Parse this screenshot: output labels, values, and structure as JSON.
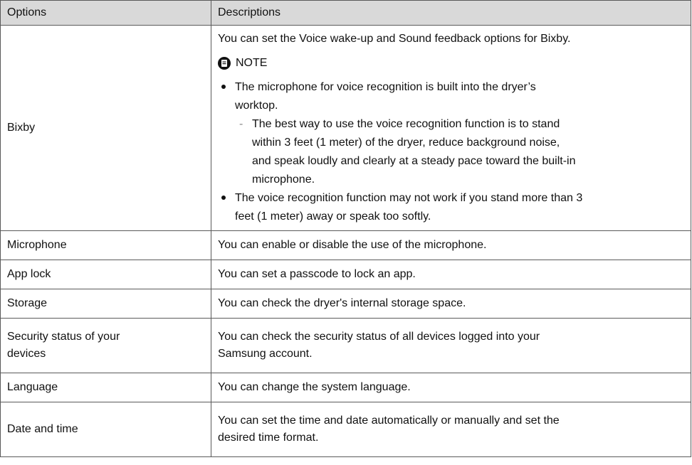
{
  "header": {
    "col_options": "Options",
    "col_descriptions": "Descriptions"
  },
  "bixby": {
    "option": "Bixby",
    "intro": "You can set the Voice wake-up and Sound feedback options for Bixby.",
    "note_label": "NOTE",
    "note_icon": "note-icon",
    "bullet1_line1": "The microphone for voice recognition is built into the dryer’s",
    "bullet1_line2": "worktop.",
    "sub1_line1": "The best way to use the voice recognition function is to stand",
    "sub1_line2": "within 3 feet (1 meter) of the dryer, reduce background noise,",
    "sub1_line3": "and speak loudly and clearly at a steady pace toward the built-in",
    "sub1_line4": "microphone.",
    "bullet2_line1": "The voice recognition function may not work if you stand more than 3",
    "bullet2_line2": "feet (1 meter) away or speak too softly.",
    "sub_dash": "-"
  },
  "rows": [
    {
      "option": "Microphone",
      "description": "You can enable or disable the use of the microphone."
    },
    {
      "option": "App lock",
      "description": "You can set a passcode to lock an app."
    },
    {
      "option": "Storage",
      "description": "You can check the dryer's internal storage space."
    },
    {
      "option_line1": "Security status of your",
      "option_line2": "devices",
      "desc_line1": "You can check the security status of all devices logged into your",
      "desc_line2": "Samsung account."
    },
    {
      "option": "Language",
      "description": "You can change the system language."
    },
    {
      "option": "Date and time",
      "desc_line1": "You can set the time and date automatically or manually and set the",
      "desc_line2": "desired time format."
    }
  ]
}
